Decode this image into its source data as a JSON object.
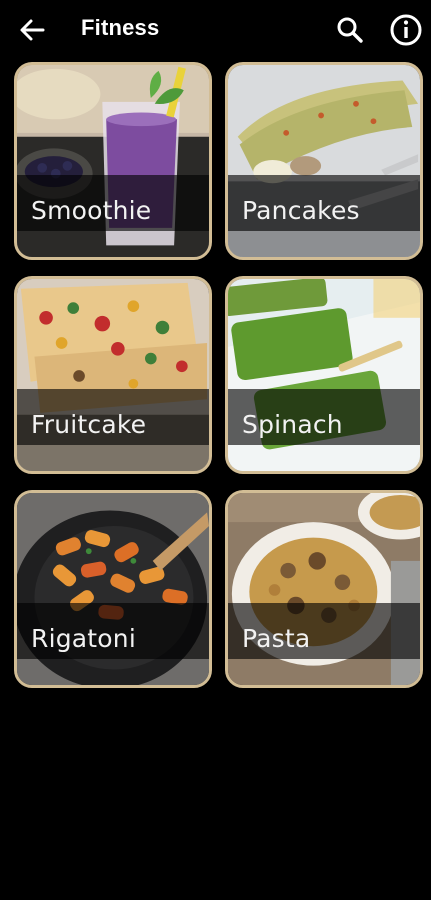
{
  "header": {
    "title": "Fitness",
    "back_icon": "arrow-left-icon",
    "search_icon": "search-icon",
    "info_icon": "info-icon"
  },
  "recipes": [
    {
      "label": "Smoothie"
    },
    {
      "label": "Pancakes"
    },
    {
      "label": "Fruitcake"
    },
    {
      "label": "Spinach"
    },
    {
      "label": "Rigatoni"
    },
    {
      "label": "Pasta"
    }
  ],
  "colors": {
    "background": "#000000",
    "card_border": "#d2bd95",
    "label_band": "rgba(0,0,0,0.62)"
  }
}
